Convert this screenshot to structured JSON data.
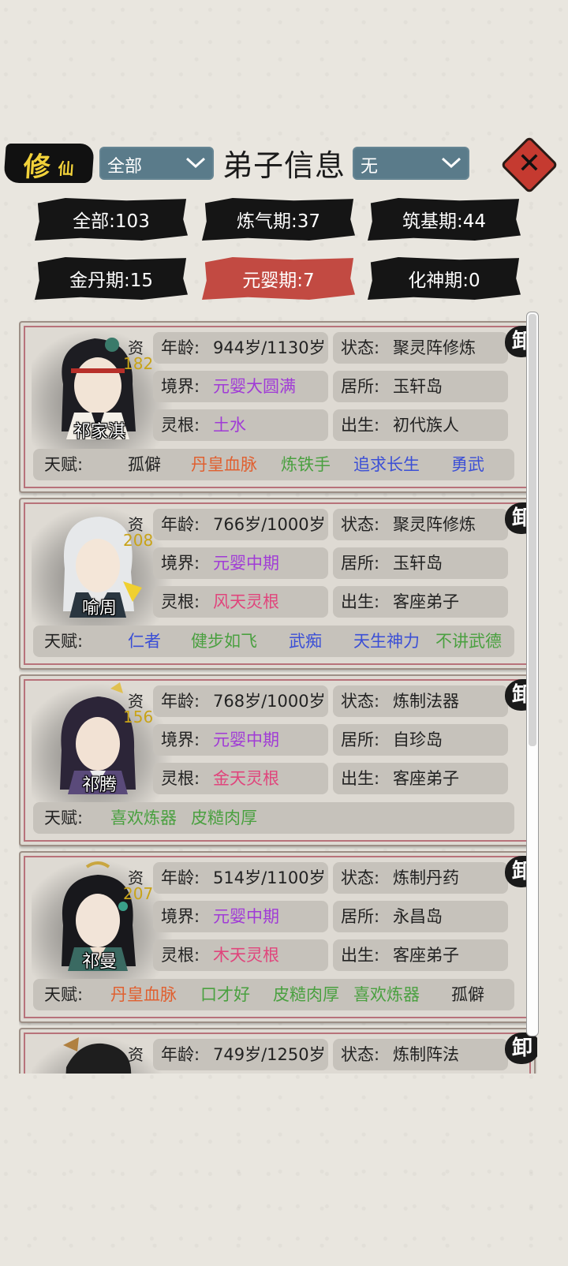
{
  "header": {
    "logo_big": "修",
    "logo_small": "仙",
    "filter_left": "全部",
    "title": "弟子信息",
    "filter_right": "无",
    "close_label": "✕"
  },
  "tabs": [
    {
      "label": "全部:103",
      "active": false
    },
    {
      "label": "炼气期:37",
      "active": false
    },
    {
      "label": "筑基期:44",
      "active": false
    },
    {
      "label": "金丹期:15",
      "active": false
    },
    {
      "label": "元婴期:7",
      "active": true
    },
    {
      "label": "化神期:0",
      "active": false
    }
  ],
  "labels": {
    "aptitude": "资",
    "age": "年龄:",
    "realm": "境界:",
    "root": "灵根:",
    "status": "状态:",
    "residence": "居所:",
    "birth": "出生:",
    "talent": "天赋:",
    "retire": "卸"
  },
  "disciples": [
    {
      "name": "祁家淇",
      "aptitude": "182",
      "age": "944岁/1130岁",
      "realm": "元婴大圆满",
      "root": "土水",
      "status": "聚灵阵修炼",
      "residence": "玉轩岛",
      "birth": "初代族人",
      "talents": [
        {
          "text": "孤僻",
          "color": "#222222"
        },
        {
          "text": "丹皇血脉",
          "color": "#e06030"
        },
        {
          "text": "炼铁手",
          "color": "#4aa040"
        },
        {
          "text": "追求长生",
          "color": "#3b4fd6"
        },
        {
          "text": "勇武",
          "color": "#3b4fd6"
        }
      ]
    },
    {
      "name": "喻周",
      "aptitude": "208",
      "age": "766岁/1000岁",
      "realm": "元婴中期",
      "root": "风天灵根",
      "status": "聚灵阵修炼",
      "residence": "玉轩岛",
      "birth": "客座弟子",
      "talents": [
        {
          "text": "仁者",
          "color": "#3b4fd6"
        },
        {
          "text": "健步如飞",
          "color": "#4aa040"
        },
        {
          "text": "武痴",
          "color": "#3b4fd6"
        },
        {
          "text": "天生神力",
          "color": "#3b4fd6"
        },
        {
          "text": "不讲武德",
          "color": "#4aa040"
        }
      ]
    },
    {
      "name": "祁腾",
      "aptitude": "156",
      "age": "768岁/1000岁",
      "realm": "元婴中期",
      "root": "金天灵根",
      "status": "炼制法器",
      "residence": "自珍岛",
      "birth": "客座弟子",
      "talents": [
        {
          "text": "喜欢炼器",
          "color": "#4aa040"
        },
        {
          "text": "皮糙肉厚",
          "color": "#4aa040"
        }
      ]
    },
    {
      "name": "祁曼",
      "aptitude": "207",
      "age": "514岁/1100岁",
      "realm": "元婴中期",
      "root": "木天灵根",
      "status": "炼制丹药",
      "residence": "永昌岛",
      "birth": "客座弟子",
      "talents": [
        {
          "text": "丹皇血脉",
          "color": "#e06030"
        },
        {
          "text": "口才好",
          "color": "#4aa040"
        },
        {
          "text": "皮糙肉厚",
          "color": "#4aa040"
        },
        {
          "text": "喜欢炼器",
          "color": "#4aa040"
        },
        {
          "text": "孤僻",
          "color": "#222222"
        }
      ]
    },
    {
      "name": "",
      "aptitude": "",
      "age": "749岁/1250岁",
      "realm": "",
      "root": "",
      "status": "炼制阵法",
      "residence": "",
      "birth": "",
      "talents": []
    }
  ],
  "colors": {
    "realm": "#a03bd6",
    "root_purple": "#a03bd6",
    "root_pink": "#e0457c",
    "aptitude": "#c8a318",
    "active_tab": "#c24a42"
  }
}
